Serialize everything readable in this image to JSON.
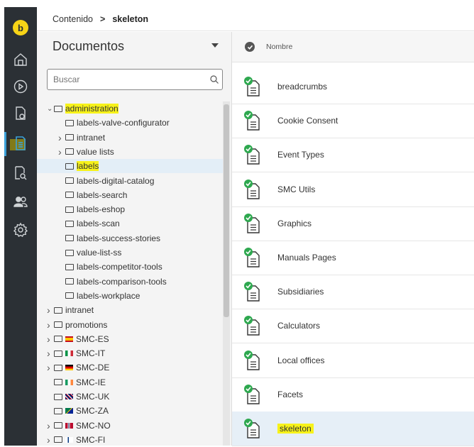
{
  "colors": {
    "rail": "#2b3035",
    "brand": "#f7d417",
    "highlight": "#f7f21a",
    "selection": "#e3eef7",
    "status_green": "#2ea84f"
  },
  "app": {
    "logo_letter": "b"
  },
  "breadcrumb": {
    "root": "Contenido",
    "separator": ">",
    "current": "skeleton"
  },
  "tree_panel": {
    "title": "Documentos",
    "search_placeholder": "Buscar",
    "items": [
      {
        "label": "administration",
        "chevron": "down",
        "highlighted": true
      },
      {
        "label": "labels-valve-configurator"
      },
      {
        "label": "intranet",
        "chevron": "right"
      },
      {
        "label": "value lists",
        "chevron": "right"
      },
      {
        "label": "labels",
        "highlighted": true,
        "selected": true
      },
      {
        "label": "labels-digital-catalog"
      },
      {
        "label": "labels-search"
      },
      {
        "label": "labels-eshop"
      },
      {
        "label": "labels-scan"
      },
      {
        "label": "labels-success-stories"
      },
      {
        "label": "value-list-ss"
      },
      {
        "label": "labels-competitor-tools"
      },
      {
        "label": "labels-comparison-tools"
      },
      {
        "label": "labels-workplace"
      },
      {
        "label": "intranet",
        "chevron": "right"
      },
      {
        "label": "promotions",
        "chevron": "right"
      },
      {
        "label": "SMC-ES",
        "chevron": "right",
        "flag": "es"
      },
      {
        "label": "SMC-IT",
        "chevron": "right",
        "flag": "it"
      },
      {
        "label": "SMC-DE",
        "chevron": "right",
        "flag": "de"
      },
      {
        "label": "SMC-IE",
        "flag": "ie"
      },
      {
        "label": "SMC-UK",
        "flag": "uk"
      },
      {
        "label": "SMC-ZA",
        "flag": "za"
      },
      {
        "label": "SMC-NO",
        "chevron": "right",
        "flag": "no"
      },
      {
        "label": "SMC-FI",
        "chevron": "right",
        "flag": "fi"
      }
    ]
  },
  "list_panel": {
    "column_header": "Nombre",
    "rows": [
      {
        "label": "breadcrumbs"
      },
      {
        "label": "Cookie Consent"
      },
      {
        "label": "Event Types"
      },
      {
        "label": "SMC Utils"
      },
      {
        "label": "Graphics"
      },
      {
        "label": "Manuals Pages"
      },
      {
        "label": "Subsidiaries"
      },
      {
        "label": "Calculators"
      },
      {
        "label": "Local offices"
      },
      {
        "label": "Facets"
      },
      {
        "label": "skeleton",
        "highlighted": true,
        "selected": true
      }
    ]
  }
}
